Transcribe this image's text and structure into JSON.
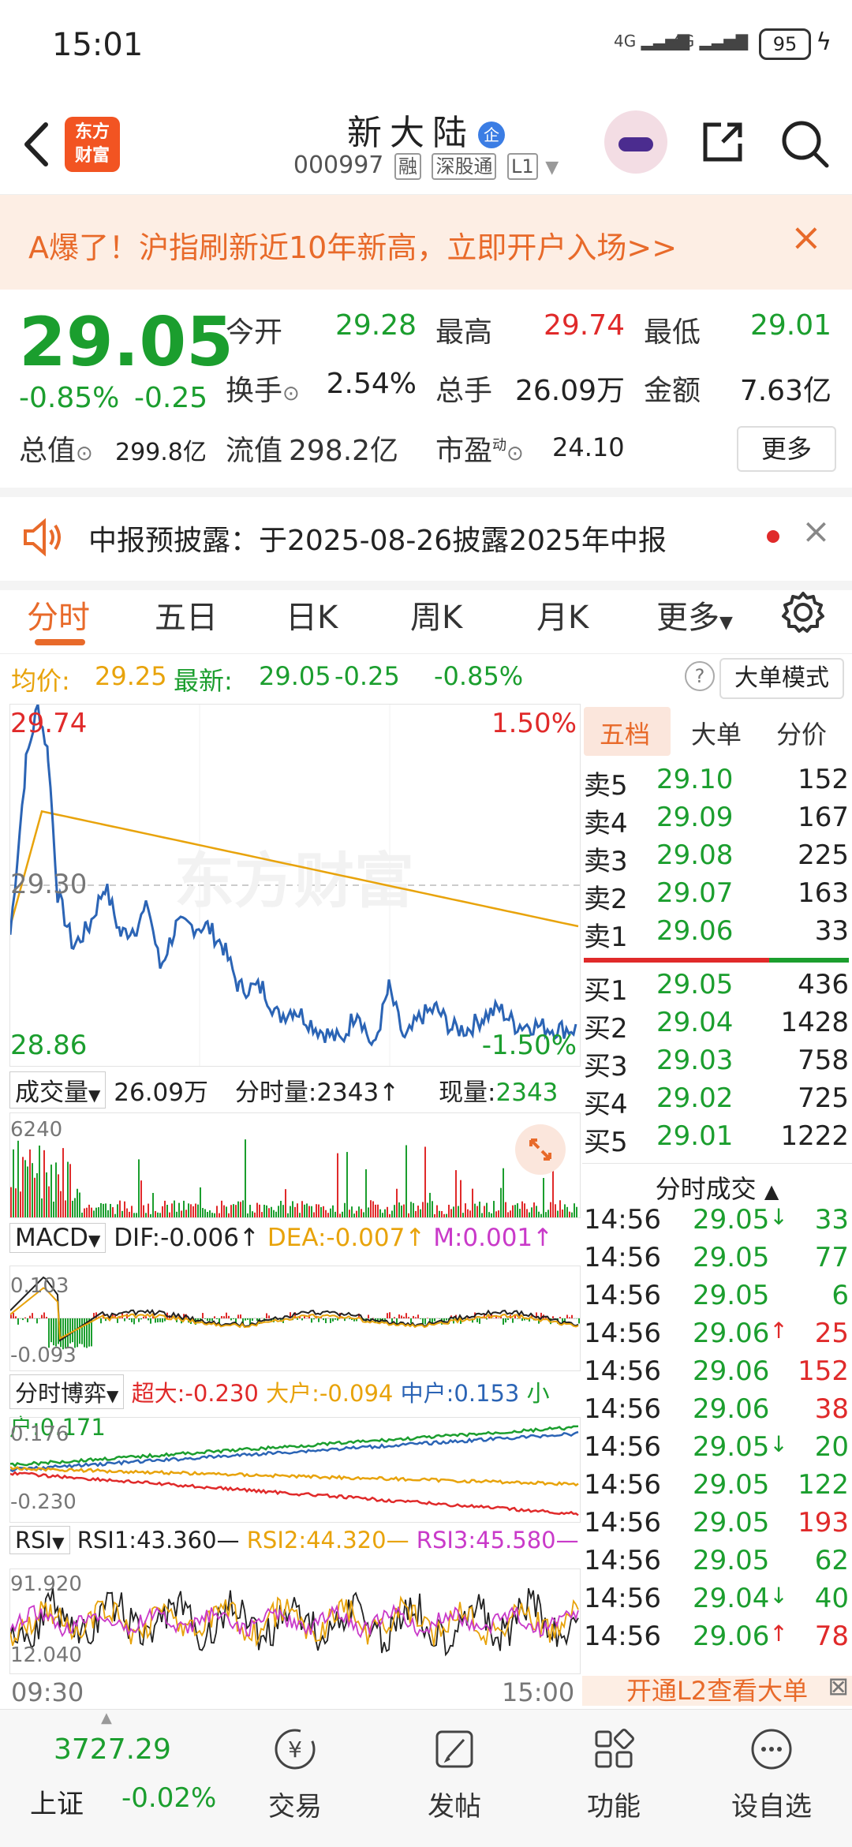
{
  "status_bar": {
    "time": "15:01",
    "signal1": "4G",
    "signal2": "4G",
    "battery": "95"
  },
  "header": {
    "logo_text_line1": "东方",
    "logo_text_line2": "财富",
    "stock_name": "新大陆",
    "qi_badge": "企",
    "code": "000997",
    "tags": [
      "融",
      "深股通",
      "L1"
    ]
  },
  "banner": {
    "text": "A爆了！沪指刷新近10年新高，立即开户入场>>",
    "close": "×"
  },
  "quote": {
    "price": "29.05",
    "change_pct": "-0.85%",
    "change": "-0.25",
    "open_label": "今开",
    "open": "29.28",
    "high_label": "最高",
    "high": "29.74",
    "low_label": "最低",
    "low": "29.01",
    "turnover_label": "换手",
    "turnover": "2.54%",
    "volume_label": "总手",
    "volume": "26.09万",
    "amount_label": "金额",
    "amount": "7.63亿",
    "mktcap_label": "总值",
    "mktcap": "299.8亿",
    "float_label": "流值",
    "float": "298.2亿",
    "pe_label": "市盈",
    "pe_sup": "动",
    "pe": "24.10",
    "more": "更多"
  },
  "notice": {
    "text": "中报预披露：于2025-08-26披露2025年中报"
  },
  "tabs": [
    "分时",
    "五日",
    "日K",
    "周K",
    "月K",
    "更多"
  ],
  "info_row": {
    "avg_label": "均价:",
    "avg": "29.25",
    "last_label": "最新:",
    "last": "29.05",
    "chg": "-0.25",
    "pct": "-0.85%",
    "help": "?",
    "big_mode": "大单模式"
  },
  "chart_labels": {
    "price_high": "29.74",
    "price_mid": "29.30",
    "price_low": "28.86",
    "pct_high": "1.50%",
    "pct_low": "-1.50%",
    "watermark": "东方财富",
    "vol_label": "成交量",
    "vol_total": "26.09万",
    "vol_fs_label": "分时量:",
    "vol_fs": "2343",
    "vol_now_label": "现量:",
    "vol_now": "2343",
    "vol_max": "6240",
    "macd_label": "MACD",
    "dif": "DIF:-0.006",
    "dea": "DEA:-0.007",
    "m": "M:0.001",
    "macd_top": "0.103",
    "macd_bot": "-0.093",
    "bo_label": "分时博弈",
    "bo_super": "超大:-0.230",
    "bo_big": "大户:-0.094",
    "bo_mid": "中户:0.153",
    "bo_small": "小户:0.171",
    "bo_top": "0.176",
    "bo_bot": "-0.230",
    "rsi_label": "RSI",
    "rsi1": "RSI1:43.360",
    "rsi2": "RSI2:44.320",
    "rsi3": "RSI3:45.580",
    "rsi_top": "91.920",
    "rsi_bot": "12.040",
    "t_start": "09:30",
    "t_end": "15:00"
  },
  "colors": {
    "up": "#e02a2a",
    "down": "#1b9e2e",
    "avg": "#e8a30b",
    "line": "#2b64b5",
    "accent": "#e86a2a"
  },
  "order_book": {
    "tabs": [
      "五档",
      "大单",
      "分价"
    ],
    "asks": [
      {
        "label": "卖5",
        "price": "29.10",
        "vol": "152"
      },
      {
        "label": "卖4",
        "price": "29.09",
        "vol": "167"
      },
      {
        "label": "卖3",
        "price": "29.08",
        "vol": "225"
      },
      {
        "label": "卖2",
        "price": "29.07",
        "vol": "163"
      },
      {
        "label": "卖1",
        "price": "29.06",
        "vol": "33"
      }
    ],
    "bids": [
      {
        "label": "买1",
        "price": "29.05",
        "vol": "436"
      },
      {
        "label": "买2",
        "price": "29.04",
        "vol": "1428"
      },
      {
        "label": "买3",
        "price": "29.03",
        "vol": "758"
      },
      {
        "label": "买4",
        "price": "29.02",
        "vol": "725"
      },
      {
        "label": "买5",
        "price": "29.01",
        "vol": "1222"
      }
    ],
    "ticks_title": "分时成交",
    "ticks": [
      {
        "time": "14:56",
        "price": "29.05",
        "dir": "↓",
        "vol": "33",
        "vc": "down"
      },
      {
        "time": "14:56",
        "price": "29.05",
        "dir": "",
        "vol": "77",
        "vc": "down"
      },
      {
        "time": "14:56",
        "price": "29.05",
        "dir": "",
        "vol": "6",
        "vc": "down"
      },
      {
        "time": "14:56",
        "price": "29.06",
        "dir": "↑",
        "vol": "25",
        "vc": "up"
      },
      {
        "time": "14:56",
        "price": "29.06",
        "dir": "",
        "vol": "152",
        "vc": "up"
      },
      {
        "time": "14:56",
        "price": "29.06",
        "dir": "",
        "vol": "38",
        "vc": "up"
      },
      {
        "time": "14:56",
        "price": "29.05",
        "dir": "↓",
        "vol": "20",
        "vc": "down"
      },
      {
        "time": "14:56",
        "price": "29.05",
        "dir": "",
        "vol": "122",
        "vc": "down"
      },
      {
        "time": "14:56",
        "price": "29.05",
        "dir": "",
        "vol": "193",
        "vc": "up"
      },
      {
        "time": "14:56",
        "price": "29.05",
        "dir": "",
        "vol": "62",
        "vc": "down"
      },
      {
        "time": "14:56",
        "price": "29.04",
        "dir": "↓",
        "vol": "40",
        "vc": "down"
      },
      {
        "time": "14:56",
        "price": "29.06",
        "dir": "↑",
        "vol": "78",
        "vc": "up"
      }
    ],
    "l2_promo": "开通L2查看大单"
  },
  "bottom_nav": {
    "index_value": "3727.29",
    "index_name": "上证",
    "index_pct": "-0.02%",
    "items": [
      {
        "label": "交易",
        "icon": "yen-trade-icon"
      },
      {
        "label": "发帖",
        "icon": "edit-post-icon"
      },
      {
        "label": "功能",
        "icon": "grid-function-icon"
      },
      {
        "label": "设自选",
        "icon": "more-dots-icon"
      }
    ]
  }
}
